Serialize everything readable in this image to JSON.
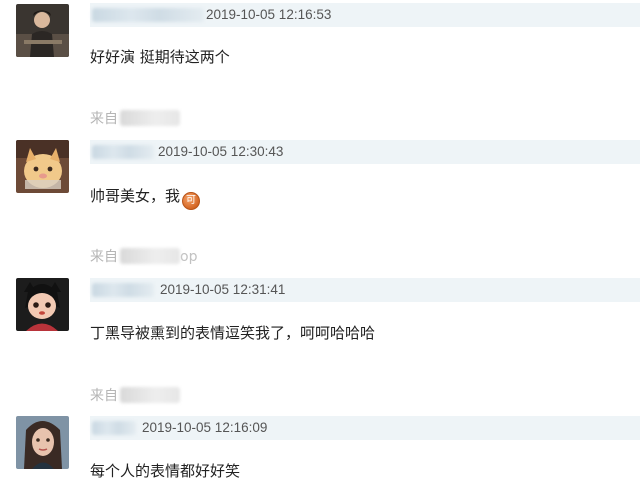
{
  "comments": [
    {
      "timestamp": "2019-10-05 12:16:53",
      "text": "好好演 挺期待这两个"
    },
    {
      "source_prefix": "来自",
      "source_tail": "",
      "timestamp": "2019-10-05 12:30:43",
      "text": "帅哥美女，我",
      "emoji_glyph": "可"
    },
    {
      "source_prefix": "来自",
      "source_tail": "op",
      "timestamp": "2019-10-05 12:31:41",
      "text": "丁黑导被熏到的表情逗笑我了，呵呵哈哈哈"
    },
    {
      "source_prefix": "来自",
      "source_tail": "",
      "timestamp": "2019-10-05 12:16:09",
      "text": "每个人的表情都好好笑"
    }
  ],
  "colors": {
    "header_bar": "#eef4f7",
    "timestamp": "#555555",
    "body_text": "#222222",
    "source_text": "#b5b5b5",
    "emoji": "#e07a36"
  }
}
